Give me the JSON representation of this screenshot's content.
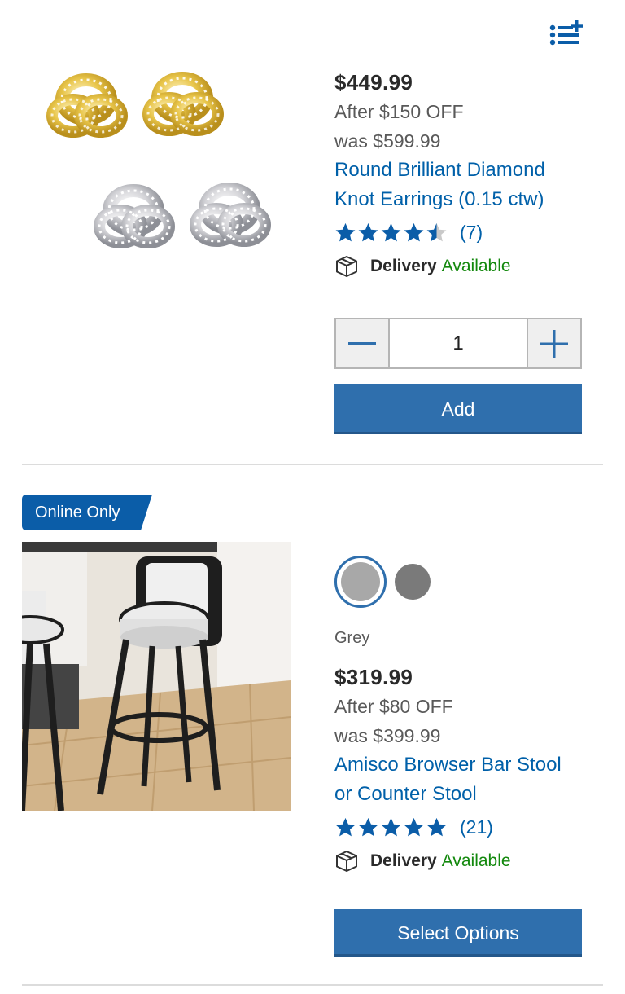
{
  "header": {
    "list_add_icon": "list-add-icon"
  },
  "products": [
    {
      "price": "$449.99",
      "discount": "After $150 OFF",
      "was": "was $599.99",
      "title_line1": "Round Brilliant Diamond",
      "title_line2": "Knot Earrings (0.15 ctw)",
      "rating": 4.5,
      "review_count": "(7)",
      "delivery_label": "Delivery",
      "delivery_status": "Available",
      "quantity": "1",
      "button_label": "Add"
    },
    {
      "badge": "Online Only",
      "selected_color": "Grey",
      "swatch_colors": [
        "#a8a8a8",
        "#7a7a7a"
      ],
      "price": "$319.99",
      "discount": "After $80 OFF",
      "was": "was $399.99",
      "title_line1": "Amisco Browser Bar Stool",
      "title_line2": "or Counter Stool",
      "rating": 5,
      "review_count": "(21)",
      "delivery_label": "Delivery",
      "delivery_status": "Available",
      "button_label": "Select Options"
    }
  ],
  "colors": {
    "link_blue": "#0060a9",
    "button_blue": "#2f6fad",
    "badge_blue": "#0b5da8",
    "available_green": "#12880c",
    "star_blue": "#0b5da8"
  }
}
